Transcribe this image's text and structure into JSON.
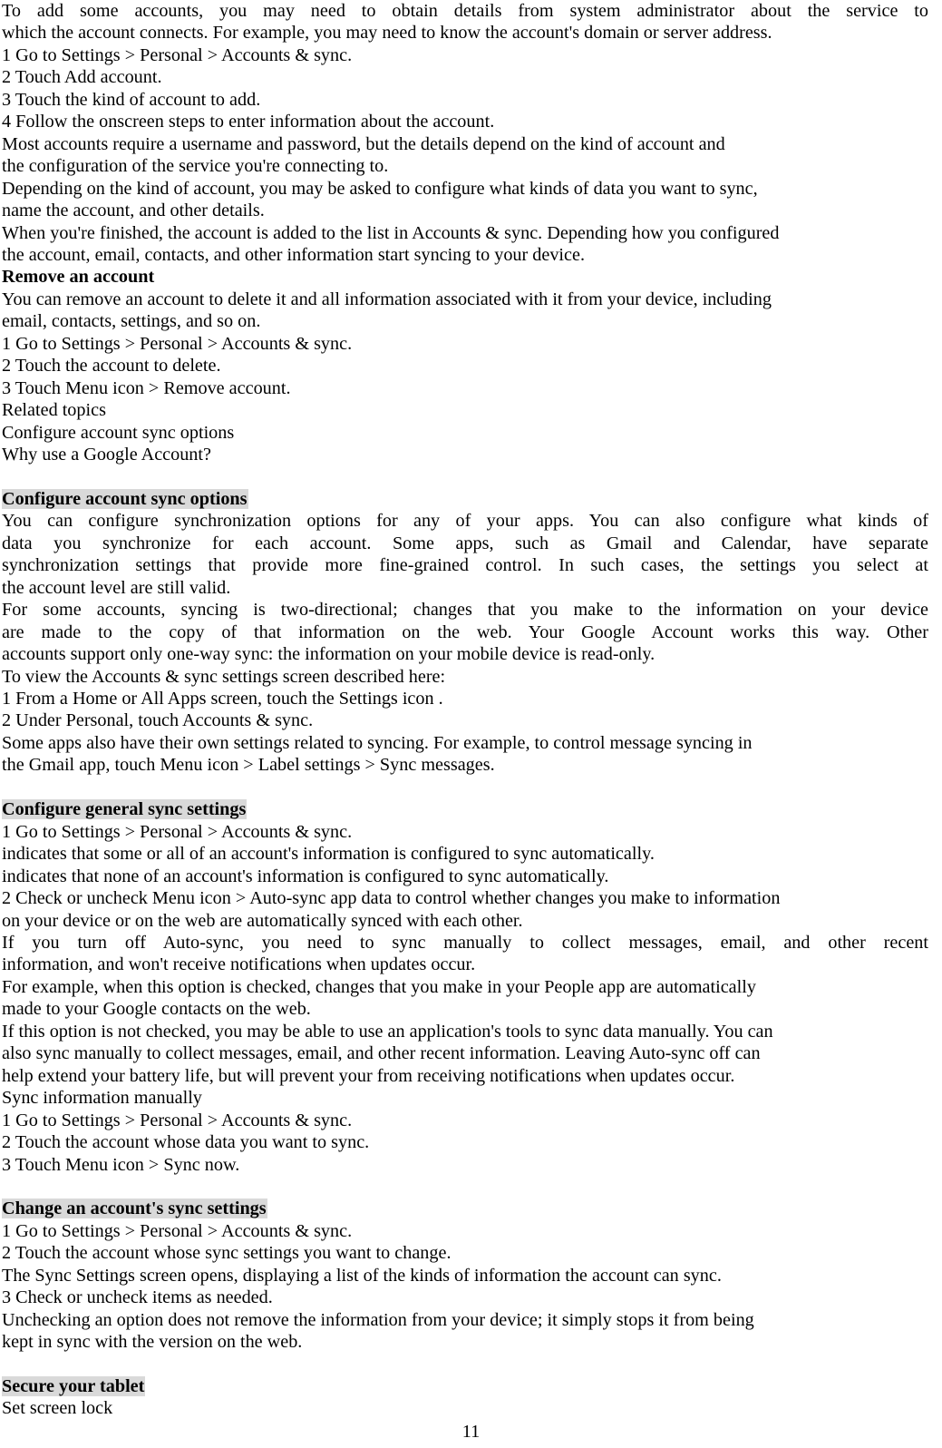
{
  "page": {
    "number": "11",
    "highlight_color": "#d9d9d9",
    "text_color": "#000000",
    "background_color": "#ffffff"
  },
  "content": {
    "intro_justified": [
      "To add some accounts, you may need to obtain details from system administrator about the service to",
      "which the account connects. For example, you may need to know the account's domain or server address."
    ],
    "add_account_steps": [
      "1 Go to Settings > Personal > Accounts & sync.",
      "2 Touch Add account.",
      "3 Touch the kind of account to add.",
      "4 Follow the onscreen steps to enter information about the account."
    ],
    "add_account_notes": [
      "Most accounts require a username and password, but the details depend on the kind of account and",
      "the configuration of the service you're connecting to.",
      "Depending on the kind of account, you may be asked to configure what kinds of data you want to sync,",
      "name the account, and other details.",
      "When you're finished, the account is added to the list in Accounts & sync. Depending how you configured",
      "the account, email, contacts, and other information start syncing to your device."
    ],
    "remove_account": {
      "heading": "Remove an account",
      "lines": [
        "You can remove an account to delete it and all information associated with it from your device, including",
        "email, contacts, settings, and so on.",
        "1 Go to Settings > Personal > Accounts & sync.",
        "2 Touch the account to delete.",
        "3 Touch Menu icon > Remove account.",
        "Related topics",
        "Configure account sync options",
        "Why use a Google Account?"
      ]
    },
    "configure_account_sync_options": {
      "heading": "Configure account sync options",
      "para1": [
        "You can configure synchronization options for any of your apps. You can also configure what kinds of",
        "data you synchronize for each account. Some apps, such as Gmail and Calendar, have separate",
        "synchronization settings that provide more fine-grained control. In such cases, the settings you select at",
        "the account level are still valid."
      ],
      "para2": [
        "For some accounts, syncing is two-directional; changes that you make to the information on your device",
        "are made to the copy of that information on the web. Your Google Account works this way. Other",
        "accounts support only one-way sync: the information on your mobile device is read-only."
      ],
      "lines": [
        "To view the Accounts & sync settings screen described here:",
        "1 From a Home or All Apps screen, touch the Settings icon .",
        "2 Under Personal, touch Accounts & sync.",
        "Some apps also have their own settings related to syncing. For example, to control message syncing in",
        "the Gmail app, touch Menu icon > Label settings > Sync messages."
      ]
    },
    "configure_general_sync_settings": {
      "heading": "Configure general sync settings",
      "lines_a": [
        "1 Go to Settings > Personal > Accounts & sync.",
        "indicates that some or all of an account's information is configured to sync automatically.",
        "indicates that none of an account's information is configured to sync automatically.",
        "2 Check or uncheck Menu icon > Auto-sync app data to control whether changes you make to information",
        "on your device or on the web are automatically synced with each other."
      ],
      "para_justified": [
        "If you turn off Auto-sync, you need to sync manually to collect messages, email, and other recent",
        "information, and won't receive notifications when updates occur."
      ],
      "lines_b": [
        "For example, when this option is checked, changes that you make in your People app are automatically",
        "made to your Google contacts on the web.",
        "If this option is not checked, you may be able to use an application's tools to sync data manually. You can",
        "also sync manually to collect messages, email, and other recent information. Leaving Auto-sync off can",
        "help extend your battery life, but will prevent your from receiving notifications when updates occur.",
        "Sync information manually",
        "1 Go to Settings > Personal > Accounts & sync.",
        "2 Touch the account whose data you want to sync.",
        "3 Touch Menu icon > Sync now."
      ]
    },
    "change_account_sync_settings": {
      "heading": "Change an account's sync settings",
      "lines": [
        "1 Go to Settings > Personal > Accounts & sync.",
        "2 Touch the account whose sync settings you want to change.",
        "The Sync Settings screen opens, displaying a list of the kinds of information the account can sync.",
        "3 Check or uncheck items as needed.",
        "Unchecking an option does not remove the information from your device; it simply stops it from being",
        "kept in sync with the version on the web."
      ]
    },
    "secure_your_tablet": {
      "heading": "Secure your tablet",
      "lines": [
        "Set screen lock"
      ]
    }
  }
}
